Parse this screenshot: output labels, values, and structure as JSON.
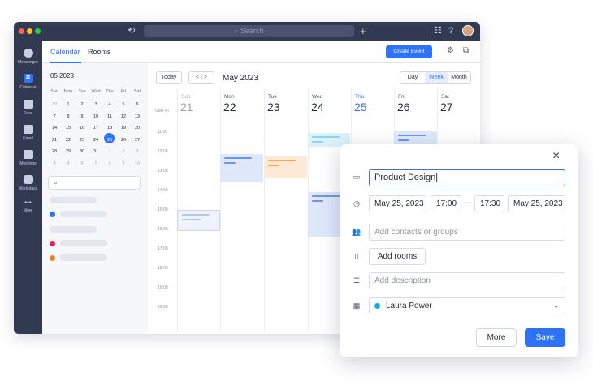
{
  "window": {
    "search_placeholder": "Search",
    "traffic_colors": [
      "#ff5f57",
      "#febc2e",
      "#28c840"
    ]
  },
  "sidebar": {
    "items": [
      {
        "label": "Messenger",
        "icon": "messenger-icon"
      },
      {
        "label": "Calendar",
        "icon": "calendar-icon",
        "badge": "25"
      },
      {
        "label": "Docs",
        "icon": "docs-icon"
      },
      {
        "label": "Email",
        "icon": "email-icon"
      },
      {
        "label": "Meetings",
        "icon": "meetings-icon"
      },
      {
        "label": "Workplace",
        "icon": "workplace-icon"
      },
      {
        "label": "More",
        "icon": "more-icon"
      }
    ]
  },
  "tabs": {
    "calendar": "Calendar",
    "rooms": "Rooms"
  },
  "create_event": "Create Event",
  "mini_calendar": {
    "title": "05 2023",
    "weekdays": [
      "Sun",
      "Mon",
      "Tue",
      "Wed",
      "Thu",
      "Fri",
      "Sat"
    ],
    "weeks": [
      [
        "30",
        "1",
        "2",
        "3",
        "4",
        "5",
        "6"
      ],
      [
        "7",
        "8",
        "9",
        "10",
        "11",
        "12",
        "13"
      ],
      [
        "14",
        "15",
        "16",
        "17",
        "18",
        "19",
        "20"
      ],
      [
        "21",
        "22",
        "23",
        "24",
        "25",
        "26",
        "27"
      ],
      [
        "28",
        "29",
        "30",
        "31",
        "1",
        "2",
        "3"
      ],
      [
        "4",
        "5",
        "6",
        "7",
        "8",
        "9",
        "10"
      ]
    ],
    "selected": "25"
  },
  "toolbar": {
    "today": "Today",
    "prev": "<",
    "next": ">",
    "month": "May 2023",
    "views": [
      "Day",
      "Week",
      "Month"
    ],
    "active_view": "Week"
  },
  "week": {
    "timezone": "GMT+8",
    "days": [
      {
        "name": "Sun",
        "num": "21"
      },
      {
        "name": "Mon",
        "num": "22"
      },
      {
        "name": "Tue",
        "num": "23"
      },
      {
        "name": "Wed",
        "num": "24"
      },
      {
        "name": "Thu",
        "num": "25"
      },
      {
        "name": "Fri",
        "num": "26"
      },
      {
        "name": "Sat",
        "num": "27"
      }
    ],
    "today_index": 4,
    "times": [
      "11:00",
      "12:00",
      "13:00",
      "14:00",
      "15:00",
      "16:00",
      "17:00",
      "18:00",
      "19:00",
      "20:00"
    ]
  },
  "dialog": {
    "title_value": "Product Design",
    "start_date": "May 25, 2023",
    "start_time": "17:00",
    "separator": "—",
    "end_time": "17:30",
    "end_date": "May 25, 2023",
    "contacts_placeholder": "Add contacts or groups",
    "add_rooms": "Add rooms",
    "description_placeholder": "Add description",
    "calendar_owner": "Laura Power",
    "more": "More",
    "save": "Save"
  },
  "colors": {
    "accent": "#2f73f5",
    "window_dark": "#323a52",
    "event_blue": "#dfe8fb",
    "event_orange": "#fde9d5",
    "event_cyan": "#dbf2fb"
  }
}
